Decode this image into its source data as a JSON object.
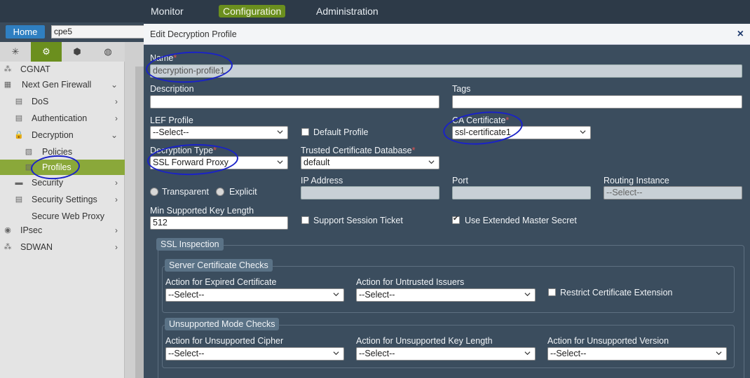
{
  "topnav": {
    "monitor": "Monitor",
    "configuration": "Configuration",
    "administration": "Administration"
  },
  "subbar": {
    "home": "Home",
    "device": "cpe5"
  },
  "sidebar": {
    "items": [
      {
        "label": "CGNAT"
      },
      {
        "label": "Next Gen Firewall"
      },
      {
        "label": "DoS"
      },
      {
        "label": "Authentication"
      },
      {
        "label": "Decryption"
      },
      {
        "label": "Policies"
      },
      {
        "label": "Profiles"
      },
      {
        "label": "Security"
      },
      {
        "label": "Security Settings"
      },
      {
        "label": "Secure Web Proxy"
      },
      {
        "label": "IPsec"
      },
      {
        "label": "SDWAN"
      }
    ]
  },
  "modal": {
    "title": "Edit Decryption Profile",
    "close": "×",
    "name": {
      "label": "Name",
      "value": "decryption-profile1"
    },
    "description": {
      "label": "Description",
      "value": ""
    },
    "tags": {
      "label": "Tags",
      "value": ""
    },
    "lef_profile": {
      "label": "LEF Profile",
      "value": "--Select--"
    },
    "default_profile": {
      "label": "Default Profile",
      "checked": false
    },
    "ca_certificate": {
      "label": "CA Certificate",
      "value": "ssl-certificate1"
    },
    "decryption_type": {
      "label": "Decryption Type",
      "value": "SSL Forward Proxy"
    },
    "trusted_db": {
      "label": "Trusted Certificate Database",
      "value": "default"
    },
    "mode": {
      "transparent": "Transparent",
      "explicit": "Explicit"
    },
    "ip_address": {
      "label": "IP Address",
      "value": ""
    },
    "port": {
      "label": "Port",
      "value": ""
    },
    "routing_instance": {
      "label": "Routing Instance",
      "value": "--Select--"
    },
    "min_key_length": {
      "label": "Min Supported Key Length",
      "value": "512"
    },
    "session_ticket": {
      "label": "Support Session Ticket",
      "checked": false
    },
    "ext_master_secret": {
      "label": "Use Extended Master Secret",
      "checked": true
    },
    "ssl_inspection": {
      "legend": "SSL Inspection",
      "server_checks": {
        "legend": "Server Certificate Checks",
        "expired": {
          "label": "Action for Expired Certificate",
          "value": "--Select--"
        },
        "untrusted": {
          "label": "Action for Untrusted Issuers",
          "value": "--Select--"
        },
        "restrict_ext": {
          "label": "Restrict Certificate Extension",
          "checked": false
        }
      },
      "unsupported": {
        "legend": "Unsupported Mode Checks",
        "cipher": {
          "label": "Action for Unsupported Cipher",
          "value": "--Select--"
        },
        "key_length": {
          "label": "Action for Unsupported Key Length",
          "value": "--Select--"
        },
        "version": {
          "label": "Action for Unsupported Version",
          "value": "--Select--"
        }
      }
    }
  },
  "colors": {
    "accent_green": "#6b8f1e",
    "modal_bg": "#3b4d5e",
    "required": "#e05252",
    "annotation": "#1a22c8"
  }
}
